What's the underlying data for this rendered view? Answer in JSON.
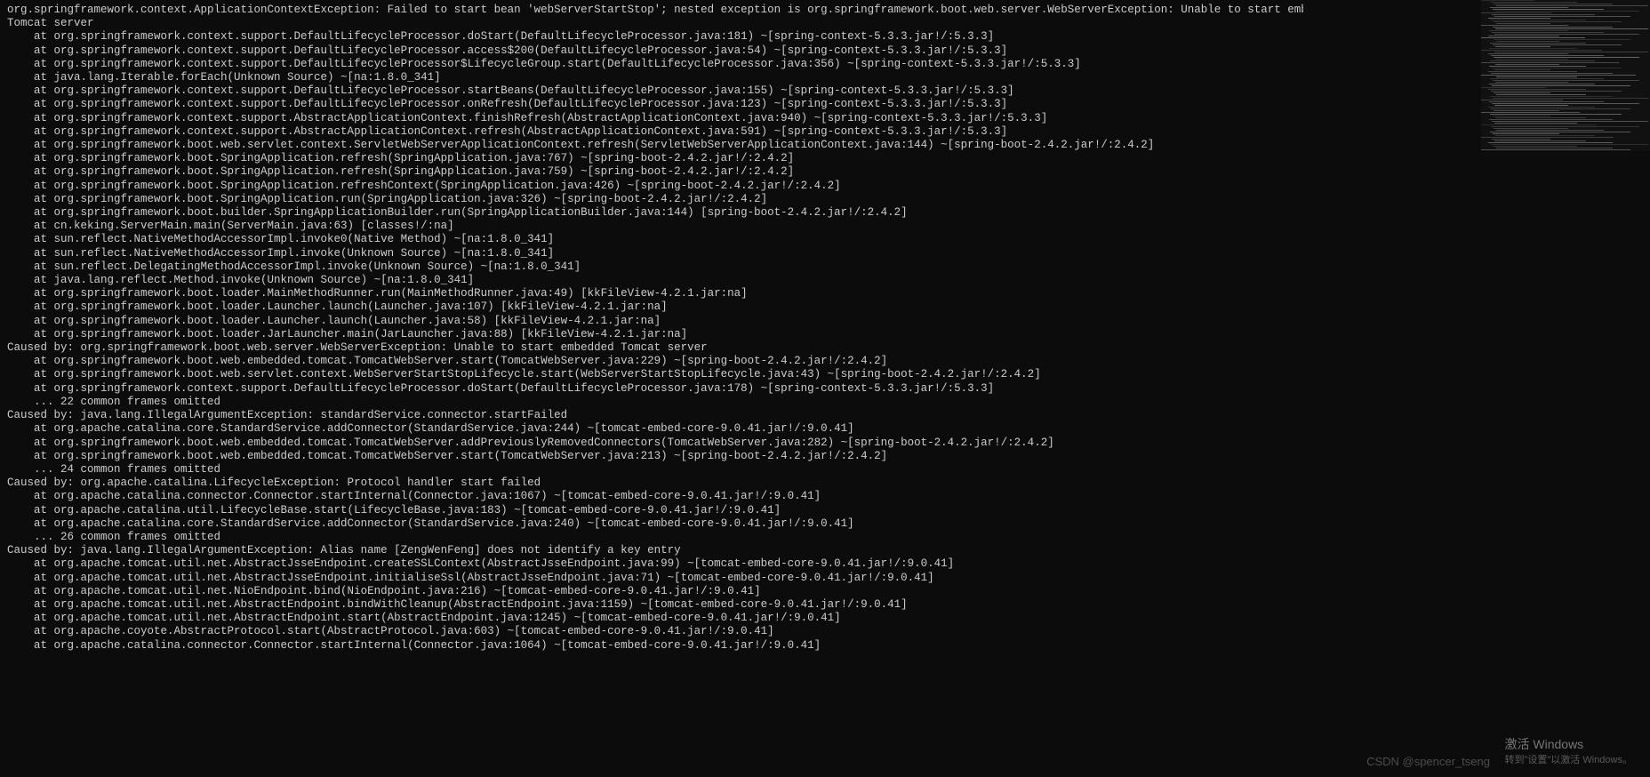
{
  "stack": [
    "org.springframework.context.ApplicationContextException: Failed to start bean 'webServerStartStop'; nested exception is org.springframework.boot.web.server.WebServerException: Unable to start embedded",
    "Tomcat server",
    "    at org.springframework.context.support.DefaultLifecycleProcessor.doStart(DefaultLifecycleProcessor.java:181) ~[spring-context-5.3.3.jar!/:5.3.3]",
    "    at org.springframework.context.support.DefaultLifecycleProcessor.access$200(DefaultLifecycleProcessor.java:54) ~[spring-context-5.3.3.jar!/:5.3.3]",
    "    at org.springframework.context.support.DefaultLifecycleProcessor$LifecycleGroup.start(DefaultLifecycleProcessor.java:356) ~[spring-context-5.3.3.jar!/:5.3.3]",
    "    at java.lang.Iterable.forEach(Unknown Source) ~[na:1.8.0_341]",
    "    at org.springframework.context.support.DefaultLifecycleProcessor.startBeans(DefaultLifecycleProcessor.java:155) ~[spring-context-5.3.3.jar!/:5.3.3]",
    "    at org.springframework.context.support.DefaultLifecycleProcessor.onRefresh(DefaultLifecycleProcessor.java:123) ~[spring-context-5.3.3.jar!/:5.3.3]",
    "    at org.springframework.context.support.AbstractApplicationContext.finishRefresh(AbstractApplicationContext.java:940) ~[spring-context-5.3.3.jar!/:5.3.3]",
    "    at org.springframework.context.support.AbstractApplicationContext.refresh(AbstractApplicationContext.java:591) ~[spring-context-5.3.3.jar!/:5.3.3]",
    "    at org.springframework.boot.web.servlet.context.ServletWebServerApplicationContext.refresh(ServletWebServerApplicationContext.java:144) ~[spring-boot-2.4.2.jar!/:2.4.2]",
    "    at org.springframework.boot.SpringApplication.refresh(SpringApplication.java:767) ~[spring-boot-2.4.2.jar!/:2.4.2]",
    "    at org.springframework.boot.SpringApplication.refresh(SpringApplication.java:759) ~[spring-boot-2.4.2.jar!/:2.4.2]",
    "    at org.springframework.boot.SpringApplication.refreshContext(SpringApplication.java:426) ~[spring-boot-2.4.2.jar!/:2.4.2]",
    "    at org.springframework.boot.SpringApplication.run(SpringApplication.java:326) ~[spring-boot-2.4.2.jar!/:2.4.2]",
    "    at org.springframework.boot.builder.SpringApplicationBuilder.run(SpringApplicationBuilder.java:144) [spring-boot-2.4.2.jar!/:2.4.2]",
    "    at cn.keking.ServerMain.main(ServerMain.java:63) [classes!/:na]",
    "    at sun.reflect.NativeMethodAccessorImpl.invoke0(Native Method) ~[na:1.8.0_341]",
    "    at sun.reflect.NativeMethodAccessorImpl.invoke(Unknown Source) ~[na:1.8.0_341]",
    "    at sun.reflect.DelegatingMethodAccessorImpl.invoke(Unknown Source) ~[na:1.8.0_341]",
    "    at java.lang.reflect.Method.invoke(Unknown Source) ~[na:1.8.0_341]",
    "    at org.springframework.boot.loader.MainMethodRunner.run(MainMethodRunner.java:49) [kkFileView-4.2.1.jar:na]",
    "    at org.springframework.boot.loader.Launcher.launch(Launcher.java:107) [kkFileView-4.2.1.jar:na]",
    "    at org.springframework.boot.loader.Launcher.launch(Launcher.java:58) [kkFileView-4.2.1.jar:na]",
    "    at org.springframework.boot.loader.JarLauncher.main(JarLauncher.java:88) [kkFileView-4.2.1.jar:na]",
    "Caused by: org.springframework.boot.web.server.WebServerException: Unable to start embedded Tomcat server",
    "    at org.springframework.boot.web.embedded.tomcat.TomcatWebServer.start(TomcatWebServer.java:229) ~[spring-boot-2.4.2.jar!/:2.4.2]",
    "    at org.springframework.boot.web.servlet.context.WebServerStartStopLifecycle.start(WebServerStartStopLifecycle.java:43) ~[spring-boot-2.4.2.jar!/:2.4.2]",
    "    at org.springframework.context.support.DefaultLifecycleProcessor.doStart(DefaultLifecycleProcessor.java:178) ~[spring-context-5.3.3.jar!/:5.3.3]",
    "    ... 22 common frames omitted",
    "Caused by: java.lang.IllegalArgumentException: standardService.connector.startFailed",
    "    at org.apache.catalina.core.StandardService.addConnector(StandardService.java:244) ~[tomcat-embed-core-9.0.41.jar!/:9.0.41]",
    "    at org.springframework.boot.web.embedded.tomcat.TomcatWebServer.addPreviouslyRemovedConnectors(TomcatWebServer.java:282) ~[spring-boot-2.4.2.jar!/:2.4.2]",
    "    at org.springframework.boot.web.embedded.tomcat.TomcatWebServer.start(TomcatWebServer.java:213) ~[spring-boot-2.4.2.jar!/:2.4.2]",
    "    ... 24 common frames omitted",
    "Caused by: org.apache.catalina.LifecycleException: Protocol handler start failed",
    "    at org.apache.catalina.connector.Connector.startInternal(Connector.java:1067) ~[tomcat-embed-core-9.0.41.jar!/:9.0.41]",
    "    at org.apache.catalina.util.LifecycleBase.start(LifecycleBase.java:183) ~[tomcat-embed-core-9.0.41.jar!/:9.0.41]",
    "    at org.apache.catalina.core.StandardService.addConnector(StandardService.java:240) ~[tomcat-embed-core-9.0.41.jar!/:9.0.41]",
    "    ... 26 common frames omitted",
    "Caused by: java.lang.IllegalArgumentException: Alias name [ZengWenFeng] does not identify a key entry",
    "    at org.apache.tomcat.util.net.AbstractJsseEndpoint.createSSLContext(AbstractJsseEndpoint.java:99) ~[tomcat-embed-core-9.0.41.jar!/:9.0.41]",
    "    at org.apache.tomcat.util.net.AbstractJsseEndpoint.initialiseSsl(AbstractJsseEndpoint.java:71) ~[tomcat-embed-core-9.0.41.jar!/:9.0.41]",
    "    at org.apache.tomcat.util.net.NioEndpoint.bind(NioEndpoint.java:216) ~[tomcat-embed-core-9.0.41.jar!/:9.0.41]",
    "    at org.apache.tomcat.util.net.AbstractEndpoint.bindWithCleanup(AbstractEndpoint.java:1159) ~[tomcat-embed-core-9.0.41.jar!/:9.0.41]",
    "    at org.apache.tomcat.util.net.AbstractEndpoint.start(AbstractEndpoint.java:1245) ~[tomcat-embed-core-9.0.41.jar!/:9.0.41]",
    "    at org.apache.coyote.AbstractProtocol.start(AbstractProtocol.java:603) ~[tomcat-embed-core-9.0.41.jar!/:9.0.41]",
    "    at org.apache.catalina.connector.Connector.startInternal(Connector.java:1064) ~[tomcat-embed-core-9.0.41.jar!/:9.0.41]"
  ],
  "watermark": {
    "title": "激活 Windows",
    "sub": "转到\"设置\"以激活 Windows。"
  },
  "csdn": "CSDN @spencer_tseng"
}
